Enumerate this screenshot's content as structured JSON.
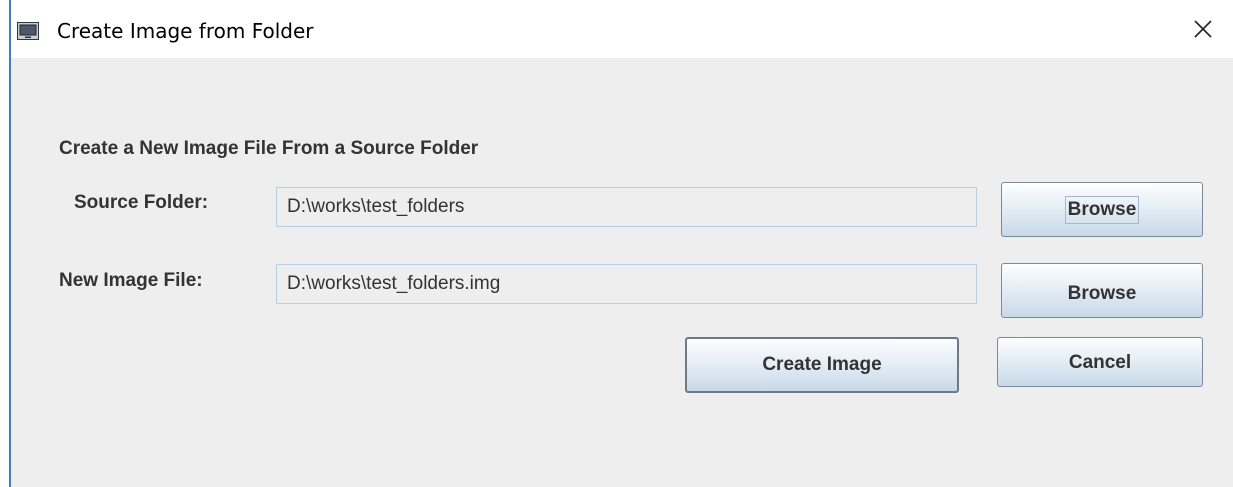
{
  "window": {
    "title": "Create Image from Folder",
    "close_symbol": "×",
    "app_icon": "monitor-icon"
  },
  "dialog": {
    "heading": "Create a New Image File From a Source Folder",
    "source_folder": {
      "label": "Source Folder:",
      "value": "D:\\works\\test_folders",
      "browse_label": "Browse"
    },
    "new_image_file": {
      "label": "New Image File:",
      "value": "D:\\works\\test_folders.img",
      "browse_label": "Browse"
    },
    "create_label": "Create Image",
    "cancel_label": "Cancel"
  },
  "colors": {
    "accent": "#3c7fc2",
    "panel": "#eeeeee",
    "field_border": "#b8cfe5",
    "text": "#333333"
  }
}
